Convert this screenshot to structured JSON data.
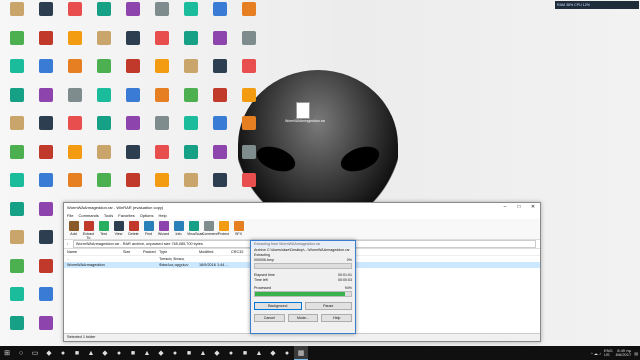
{
  "desktop": {
    "perf_widget": "RAM 38%  CPU 12%",
    "rar_file_label": "WormWAArmageddon.rar",
    "icon_colors": [
      "#c9a56b",
      "#3a7bd5",
      "#e94e4e",
      "#4caf50",
      "#8e44ad",
      "#f39c12",
      "#1abc9c",
      "#2c3e50",
      "#e67e22",
      "#16a085",
      "#c0392b",
      "#7f8c8d"
    ]
  },
  "winrar": {
    "title": "WormWAArmageddon.rar - WinRAR (evaluation copy)",
    "menu": [
      "File",
      "Commands",
      "Tools",
      "Favorites",
      "Options",
      "Help"
    ],
    "toolbar": [
      "Add",
      "Extract To",
      "Test",
      "View",
      "Delete",
      "Find",
      "Wizard",
      "Info",
      "VirusScan",
      "Comment",
      "Protect",
      "SFX"
    ],
    "address": "WormWAArmageddon.rar - RAR archive, unpacked size 765,085,700 bytes",
    "columns": {
      "name": "Name",
      "size": "Size",
      "packed": "Packed",
      "type": "Type",
      "modified": "Modified",
      "crc": "CRC32"
    },
    "rows": [
      {
        "name": "..",
        "size": "",
        "packed": "",
        "type": "Τοπικός δίσκος",
        "modified": "",
        "crc": ""
      },
      {
        "name": "WormWAArmageddon",
        "size": "",
        "packed": "",
        "type": "Φάκελος αρχείων",
        "modified": "16/9/2016 1:44 ...",
        "crc": ""
      }
    ],
    "status": "Selected 1 folder"
  },
  "progress": {
    "title": "Extracting from WormWAArmageddon.rar",
    "archive_line": "Archive C:\\Users\\skse\\Desktop\\...\\WormWAArmageddon.rar",
    "action": "Extracting",
    "current_file": "000006.bmp",
    "file_pct": "0%",
    "elapsed_label": "Elapsed time",
    "elapsed": "00:01:01",
    "left_label": "Time left",
    "left": "00:00:03",
    "processed_label": "Processed",
    "processed_pct": "94%",
    "processed_value": 0.94,
    "buttons": {
      "background": "Background",
      "pause": "Pause",
      "cancel": "Cancel",
      "mode": "Mode...",
      "help": "Help"
    }
  },
  "taskbar": {
    "lang": "ENG",
    "region": "US",
    "time": "8:49 πμ",
    "date": "8/6/2017"
  }
}
